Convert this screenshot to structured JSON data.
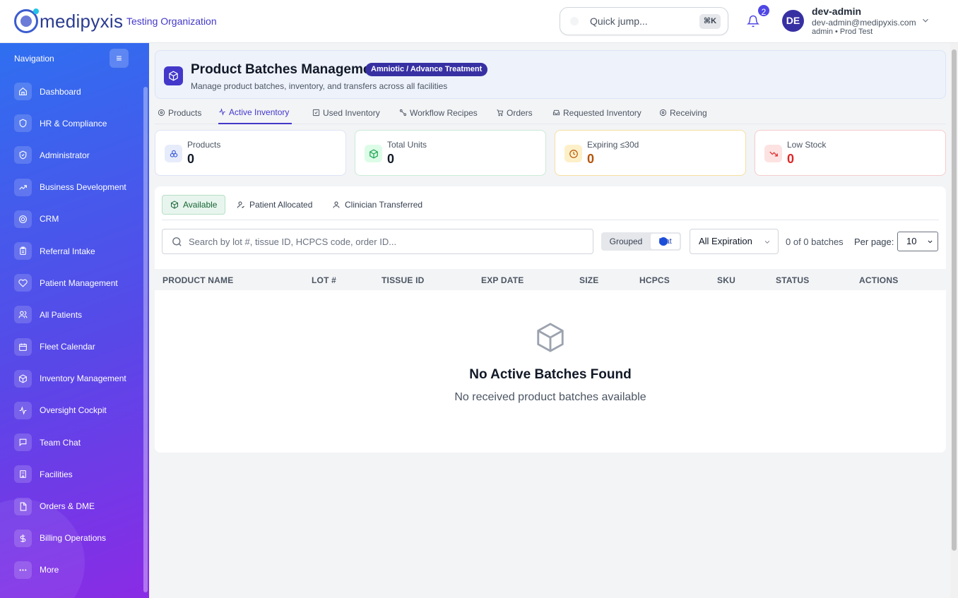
{
  "header": {
    "logo_text": "medipyxis",
    "organization": "Testing Organization",
    "quick_jump_placeholder": "Quick jump...",
    "quick_jump_shortcut": "⌘K",
    "notification_count": "2",
    "avatar_initials": "DE",
    "user_name": "dev-admin",
    "user_email": "dev-admin@medipyxis.com",
    "user_role": "admin • Prod Test"
  },
  "sidebar": {
    "title": "Navigation",
    "toggle_icon": "≡",
    "items": [
      {
        "label": "Dashboard",
        "icon": "home-icon"
      },
      {
        "label": "HR & Compliance",
        "icon": "shield-icon"
      },
      {
        "label": "Administrator",
        "icon": "shield-check-icon"
      },
      {
        "label": "Business Development",
        "icon": "trending-up-icon"
      },
      {
        "label": "CRM",
        "icon": "target-icon"
      },
      {
        "label": "Referral Intake",
        "icon": "clipboard-icon"
      },
      {
        "label": "Patient Management",
        "icon": "heart-icon"
      },
      {
        "label": "All Patients",
        "icon": "users-icon"
      },
      {
        "label": "Fleet Calendar",
        "icon": "calendar-icon"
      },
      {
        "label": "Inventory Management",
        "icon": "package-icon"
      },
      {
        "label": "Oversight Cockpit",
        "icon": "activity-icon"
      },
      {
        "label": "Team Chat",
        "icon": "chat-icon"
      },
      {
        "label": "Facilities",
        "icon": "building-icon"
      },
      {
        "label": "Orders & DME",
        "icon": "file-icon"
      },
      {
        "label": "Billing Operations",
        "icon": "dollar-icon"
      },
      {
        "label": "More",
        "icon": "more-icon"
      }
    ]
  },
  "page": {
    "title": "Product Batches Management",
    "badge": "Amniotic / Advance Treatment",
    "subtitle": "Manage product batches, inventory, and transfers across all facilities"
  },
  "tabs": [
    {
      "label": "Products",
      "icon": "gear-icon",
      "active": false
    },
    {
      "label": "Active Inventory",
      "icon": "activity-icon",
      "active": true
    },
    {
      "label": "Used Inventory",
      "icon": "check-square-icon",
      "active": false
    },
    {
      "label": "Workflow Recipes",
      "icon": "workflow-icon",
      "active": false
    },
    {
      "label": "Orders",
      "icon": "cart-icon",
      "active": false
    },
    {
      "label": "Requested Inventory",
      "icon": "inbox-icon",
      "active": false
    },
    {
      "label": "Receiving",
      "icon": "gear-icon",
      "active": false
    }
  ],
  "stats": [
    {
      "label": "Products",
      "value": "0",
      "icon": "cubes-icon",
      "color": "#3b5bdb",
      "bg": "#e7ecfb",
      "border": "#dbe3f5",
      "value_color": "#111827"
    },
    {
      "label": "Total Units",
      "value": "0",
      "icon": "box-icon",
      "color": "#16a34a",
      "bg": "#dcfce7",
      "border": "#c9ecd6",
      "value_color": "#111827"
    },
    {
      "label": "Expiring ≤30d",
      "value": "0",
      "icon": "clock-icon",
      "color": "#b45309",
      "bg": "#fdf0c8",
      "border": "#f6dfa0",
      "value_color": "#b45309"
    },
    {
      "label": "Low Stock",
      "value": "0",
      "icon": "trending-down-icon",
      "color": "#dc2626",
      "bg": "#fde2e2",
      "border": "#f6cccc",
      "value_color": "#dc2626"
    }
  ],
  "subtabs": [
    {
      "label": "Available",
      "icon": "box-icon",
      "active": true
    },
    {
      "label": "Patient Allocated",
      "icon": "user-icon",
      "active": false
    },
    {
      "label": "Clinician Transferred",
      "icon": "user-icon",
      "active": false
    }
  ],
  "toolbar": {
    "search_placeholder": "Search by lot #, tissue ID, HCPCS code, order ID...",
    "grouped_label": "Grouped",
    "flat_label": "Flat",
    "expiration_filter": "All Expiration",
    "batch_count": "0 of 0 batches",
    "per_page_label": "Per page:",
    "per_page_value": "10"
  },
  "table": {
    "columns": [
      "PRODUCT NAME",
      "LOT #",
      "TISSUE ID",
      "EXP DATE",
      "SIZE",
      "HCPCS",
      "SKU",
      "STATUS",
      "ACTIONS"
    ]
  },
  "empty_state": {
    "title": "No Active Batches Found",
    "subtitle": "No received product batches available"
  }
}
